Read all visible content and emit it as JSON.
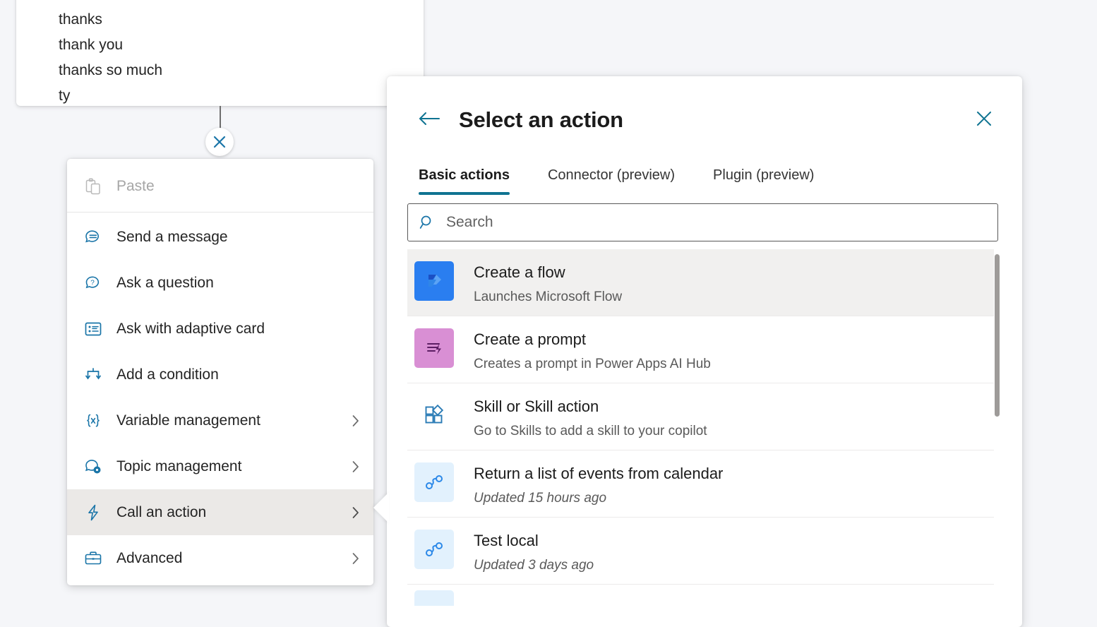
{
  "canvas": {
    "node_card": {
      "lines": [
        "thanks",
        "thank you",
        "thanks so much",
        "ty"
      ]
    },
    "close_node_icon": "close-icon"
  },
  "context_menu": {
    "items": [
      {
        "label": "Paste",
        "icon": "clipboard-paste-icon",
        "disabled": true,
        "has_submenu": false,
        "selected": false
      },
      {
        "label": "Send a message",
        "icon": "message-icon",
        "disabled": false,
        "has_submenu": false,
        "selected": false
      },
      {
        "label": "Ask a question",
        "icon": "question-bubble-icon",
        "disabled": false,
        "has_submenu": false,
        "selected": false
      },
      {
        "label": "Ask with adaptive card",
        "icon": "adaptive-card-icon",
        "disabled": false,
        "has_submenu": false,
        "selected": false
      },
      {
        "label": "Add a condition",
        "icon": "branch-icon",
        "disabled": false,
        "has_submenu": false,
        "selected": false
      },
      {
        "label": "Variable management",
        "icon": "variable-braces-icon",
        "disabled": false,
        "has_submenu": true,
        "selected": false
      },
      {
        "label": "Topic management",
        "icon": "topic-gear-icon",
        "disabled": false,
        "has_submenu": true,
        "selected": false
      },
      {
        "label": "Call an action",
        "icon": "lightning-bolt-icon",
        "disabled": false,
        "has_submenu": true,
        "selected": true
      },
      {
        "label": "Advanced",
        "icon": "briefcase-icon",
        "disabled": false,
        "has_submenu": true,
        "selected": false
      }
    ]
  },
  "panel": {
    "title": "Select an action",
    "back_icon": "arrow-left-icon",
    "close_icon": "close-icon",
    "tabs": [
      {
        "label": "Basic actions",
        "active": true
      },
      {
        "label": "Connector (preview)",
        "active": false
      },
      {
        "label": "Plugin (preview)",
        "active": false
      }
    ],
    "search": {
      "placeholder": "Search",
      "value": "",
      "icon": "search-icon"
    },
    "actions": [
      {
        "title": "Create a flow",
        "subtitle": "Launches Microsoft Flow",
        "icon": "power-automate-icon",
        "icon_bg": "#2a7ef0",
        "subtitle_italic": false,
        "highlighted": true
      },
      {
        "title": "Create a prompt",
        "subtitle": "Creates a prompt in Power Apps AI Hub",
        "icon": "ai-prompt-icon",
        "icon_bg": "#d98fd4",
        "subtitle_italic": false,
        "highlighted": false
      },
      {
        "title": "Skill or Skill action",
        "subtitle": "Go to Skills to add a skill to your copilot",
        "icon": "skill-puzzle-icon",
        "icon_bg": "#ffffff",
        "subtitle_italic": false,
        "highlighted": false
      },
      {
        "title": "Return a list of events from calendar",
        "subtitle": "Updated 15 hours ago",
        "icon": "flow-connector-icon",
        "icon_bg": "#e2f1fd",
        "subtitle_italic": true,
        "highlighted": false
      },
      {
        "title": "Test local",
        "subtitle": "Updated 3 days ago",
        "icon": "flow-connector-icon",
        "icon_bg": "#e2f1fd",
        "subtitle_italic": true,
        "highlighted": false
      }
    ],
    "scrollbar": {
      "position": "right",
      "thumb_top_pct": 1,
      "thumb_height_pct": 48
    }
  },
  "colors": {
    "accent": "#0f7391",
    "icon_blue": "#1a75a8",
    "canvas_bg": "#f5f6f9",
    "selected_row": "#f1f0ef",
    "selected_menu_item": "#ebe9e7"
  }
}
